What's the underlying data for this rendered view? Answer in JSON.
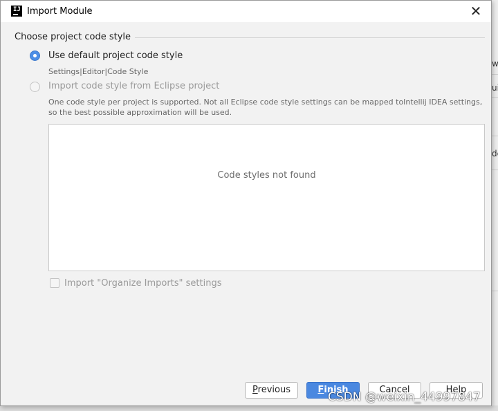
{
  "window": {
    "title": "Import Module",
    "app_icon": "intellij-idea-icon",
    "close_icon": "close-icon",
    "close_glyph": "✕"
  },
  "section": {
    "title": "Choose project code style"
  },
  "options": {
    "default": {
      "label": "Use default project code style",
      "hint": "Settings|Editor|Code Style",
      "selected": true
    },
    "eclipse": {
      "label": "Import code style from Eclipse project",
      "description_line1": "One code style per project is supported. Not all Eclipse code style settings can be mapped toIntellij IDEA settings,",
      "description_line2": "so the best possible approximation will be used.",
      "enabled": false,
      "selected": false
    }
  },
  "styles_list": {
    "empty_text": "Code styles not found"
  },
  "organize_imports": {
    "label": "Import \"Organize Imports\" settings",
    "checked": false,
    "enabled": false
  },
  "buttons": {
    "previous": {
      "mnemonic": "P",
      "rest": "revious"
    },
    "finish": {
      "mnemonic": "F",
      "rest": "inish"
    },
    "cancel": {
      "label": "Cancel"
    },
    "help": {
      "label": "Help"
    }
  },
  "watermark": "CSDN @weixin_44997847",
  "background_fragments": [
    "w",
    "ui",
    "de"
  ],
  "colors": {
    "accent": "#4a88e0",
    "dialog_bg": "#f2f2f2",
    "disabled_text": "#9a9a9a"
  }
}
